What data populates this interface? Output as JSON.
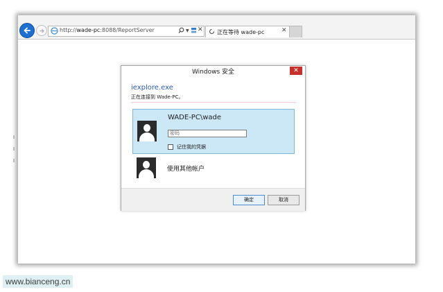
{
  "browser": {
    "address_bar": {
      "url_prefix": "http://",
      "url_host": "wade-pc",
      "url_rest": ":8088/ReportServer"
    },
    "tab": {
      "title": "正在等待 wade-pc"
    }
  },
  "dialog": {
    "title": "Windows 安全",
    "close_glyph": "✕",
    "app_name": "iexplore.exe",
    "connecting_text": "正在连接到 Wade-PC。",
    "selected_credential": {
      "user": "WADE-PC\\wade",
      "password_placeholder": "密码",
      "remember_label": "记住我的凭据"
    },
    "other_account_label": "使用其他帐户",
    "buttons": {
      "ok": "确定",
      "cancel": "取消"
    }
  },
  "watermark": "www.bianceng.cn",
  "colors": {
    "accent": "#1e6fd0",
    "selection_bg": "#cce8f6",
    "close_red": "#c8302c"
  }
}
